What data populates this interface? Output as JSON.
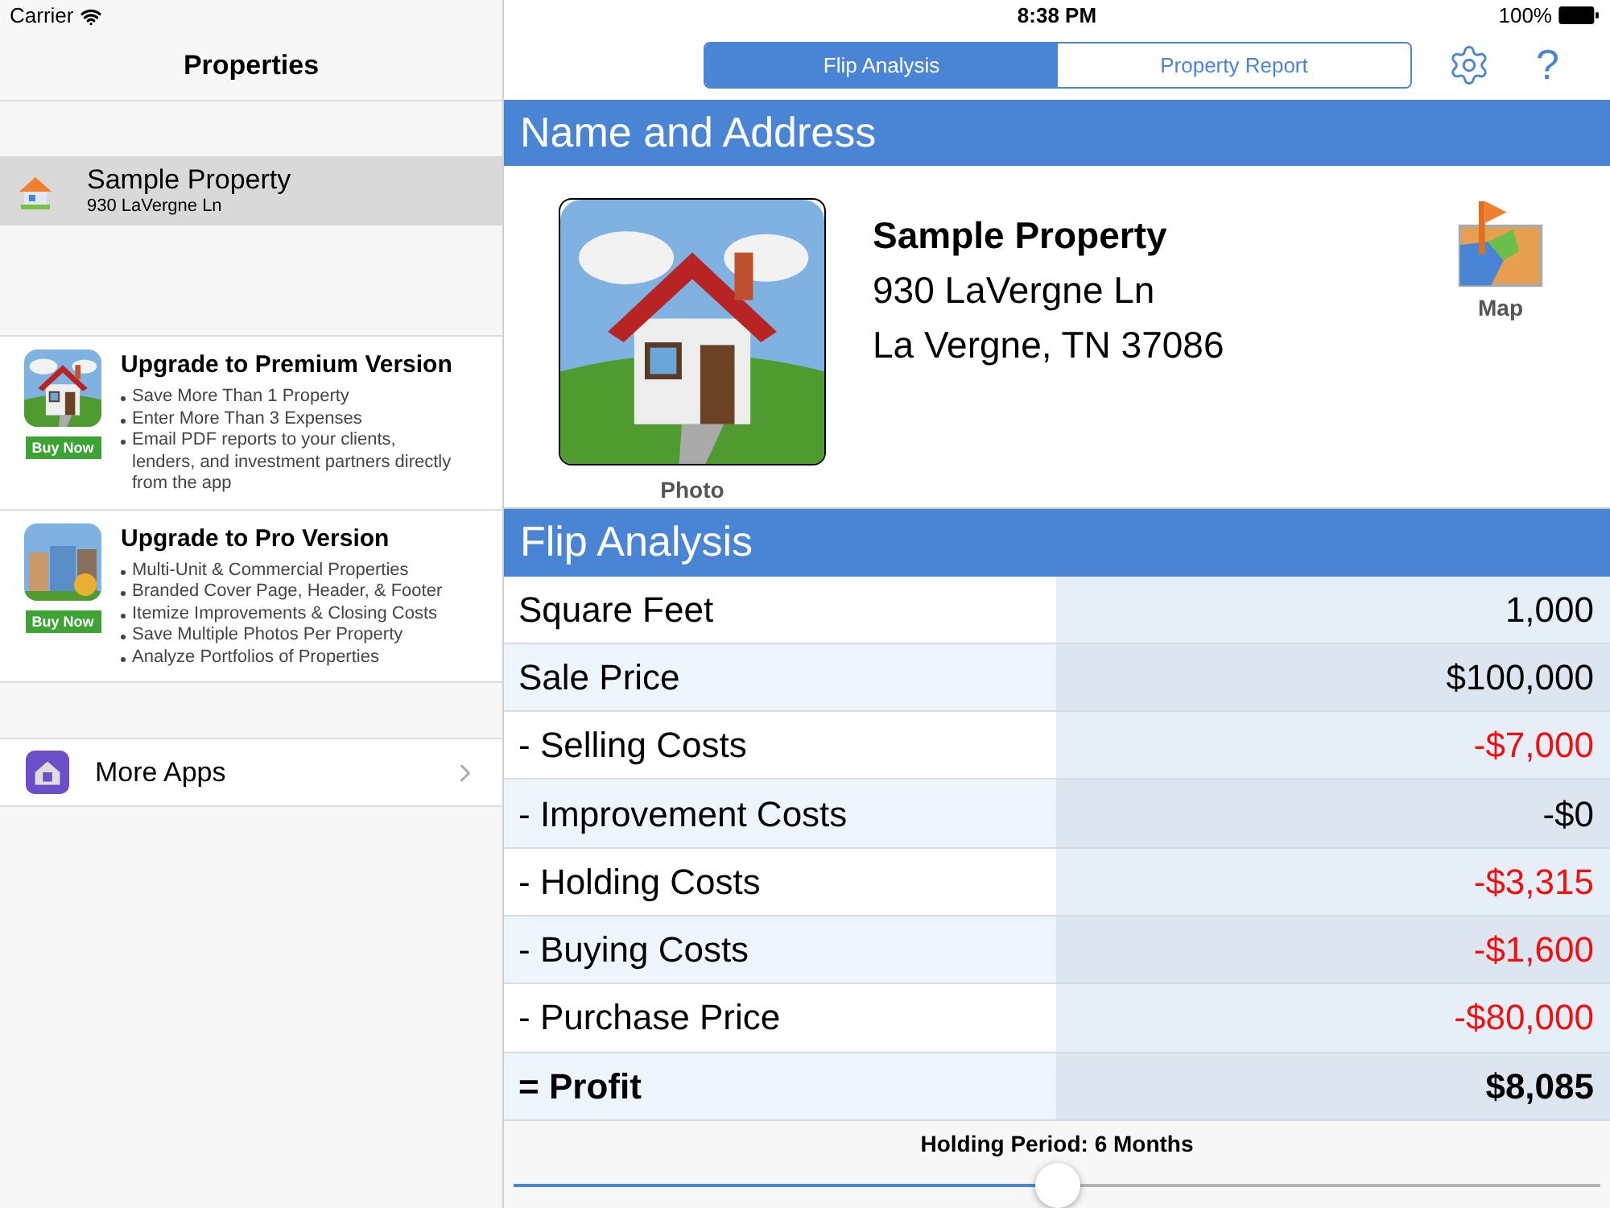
{
  "status_bar": {
    "carrier": "Carrier",
    "time": "8:38 PM",
    "battery": "100%"
  },
  "sidebar": {
    "title": "Properties",
    "properties": [
      {
        "name": "Sample Property",
        "address": "930 LaVergne Ln",
        "selected": true
      }
    ],
    "upgrades": [
      {
        "kind": "premium",
        "title": "Upgrade to Premium Version",
        "button": "Buy Now",
        "features": [
          "Save More Than 1 Property",
          "Enter More Than 3 Expenses",
          "Email PDF reports to your clients, lenders, and investment partners directly from the app"
        ]
      },
      {
        "kind": "pro",
        "title": "Upgrade to Pro Version",
        "button": "Buy Now",
        "features": [
          "Multi-Unit & Commercial Properties",
          "Branded Cover Page, Header, & Footer",
          "Itemize Improvements & Closing Costs",
          "Save Multiple Photos Per Property",
          "Analyze Portfolios of Properties"
        ]
      }
    ],
    "more_apps": "More Apps"
  },
  "help_button": "?",
  "tabs": [
    {
      "label": "Flip Analysis",
      "selected": true
    },
    {
      "label": "Property Report",
      "selected": false
    }
  ],
  "name_section": {
    "heading": "Name and Address",
    "photo_label": "Photo",
    "name": "Sample Property",
    "address_lines": [
      "930 LaVergne Ln",
      "La Vergne, TN 37086"
    ],
    "map_label": "Map"
  },
  "analysis": {
    "heading": "Flip Analysis",
    "rows": [
      {
        "kind": "item",
        "label": "Square Feet",
        "value": "1,000",
        "negative": false
      },
      {
        "kind": "item",
        "label": "Sale Price",
        "value": "$100,000",
        "negative": false
      },
      {
        "kind": "item",
        "label": "- Selling Costs",
        "value": "-$7,000",
        "negative": true
      },
      {
        "kind": "item",
        "label": "- Improvement Costs",
        "value": "-$0",
        "negative": false
      },
      {
        "kind": "item",
        "label": "- Holding Costs",
        "value": "-$3,315",
        "negative": true
      },
      {
        "kind": "item",
        "label": "- Buying Costs",
        "value": "-$1,600",
        "negative": true
      },
      {
        "kind": "item",
        "label": "- Purchase Price",
        "value": "-$80,000",
        "negative": true
      },
      {
        "kind": "total",
        "label": "= Profit",
        "value": "$8,085",
        "negative": false
      }
    ]
  },
  "holding_period": {
    "label": "Holding Period: 6 Months",
    "level": 0.5
  }
}
